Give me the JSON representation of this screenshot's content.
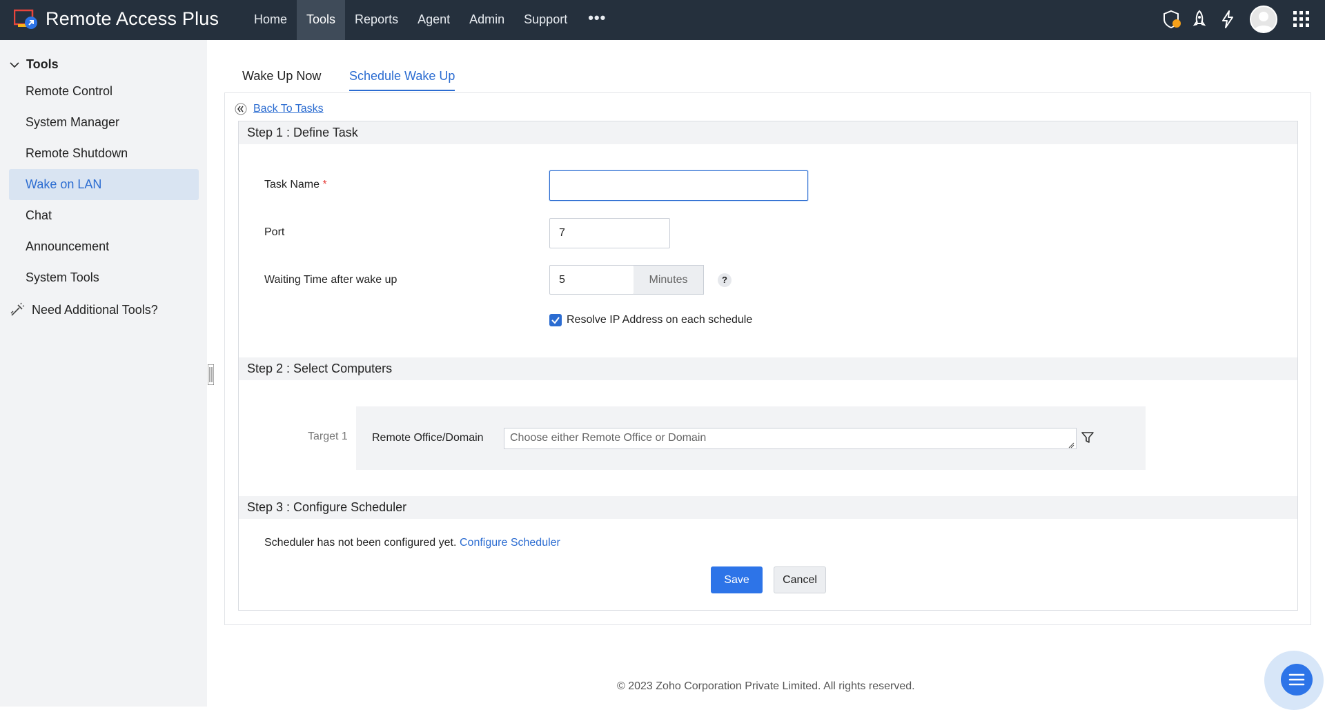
{
  "app": {
    "title": "Remote Access Plus"
  },
  "nav": {
    "items": [
      {
        "label": "Home"
      },
      {
        "label": "Tools"
      },
      {
        "label": "Reports"
      },
      {
        "label": "Agent"
      },
      {
        "label": "Admin"
      },
      {
        "label": "Support"
      }
    ],
    "more_label": "•••",
    "active": "Tools"
  },
  "top_icons": [
    "shield-alert-icon",
    "rocket-icon",
    "lightning-icon",
    "user-avatar",
    "apps-grid-icon"
  ],
  "sidebar": {
    "section": "Tools",
    "items": [
      {
        "label": "Remote Control"
      },
      {
        "label": "System Manager"
      },
      {
        "label": "Remote Shutdown"
      },
      {
        "label": "Wake on LAN"
      },
      {
        "label": "Chat"
      },
      {
        "label": "Announcement"
      },
      {
        "label": "System Tools"
      }
    ],
    "active": "Wake on LAN",
    "additional": "Need Additional Tools?"
  },
  "tabs": [
    {
      "label": "Wake Up Now"
    },
    {
      "label": "Schedule Wake Up"
    }
  ],
  "active_tab": "Schedule Wake Up",
  "back_link": "Back To Tasks",
  "step1": {
    "title": "Step 1 : Define Task",
    "task_name_label": "Task Name",
    "required_mark": "*",
    "task_name_value": "",
    "port_label": "Port",
    "port_value": "7",
    "wait_label": "Waiting Time after wake up",
    "wait_value": "5",
    "wait_unit": "Minutes",
    "help": "?",
    "resolve_ip_label": "Resolve IP Address on each schedule",
    "resolve_ip_checked": true
  },
  "step2": {
    "title": "Step 2 : Select Computers",
    "target_label": "Target 1",
    "field_label": "Remote Office/Domain",
    "placeholder": "Choose either Remote Office or Domain"
  },
  "step3": {
    "title": "Step 3 : Configure Scheduler",
    "status_text": "Scheduler has not been configured yet.",
    "configure_link": "Configure Scheduler"
  },
  "buttons": {
    "save": "Save",
    "cancel": "Cancel"
  },
  "footer": "© 2023 Zoho Corporation Private Limited.  All rights reserved.",
  "colors": {
    "topbar": "#25303d",
    "accent": "#2b6cd1",
    "sidebar_bg": "#f2f3f5",
    "active_item_bg": "#d9e4f2"
  }
}
